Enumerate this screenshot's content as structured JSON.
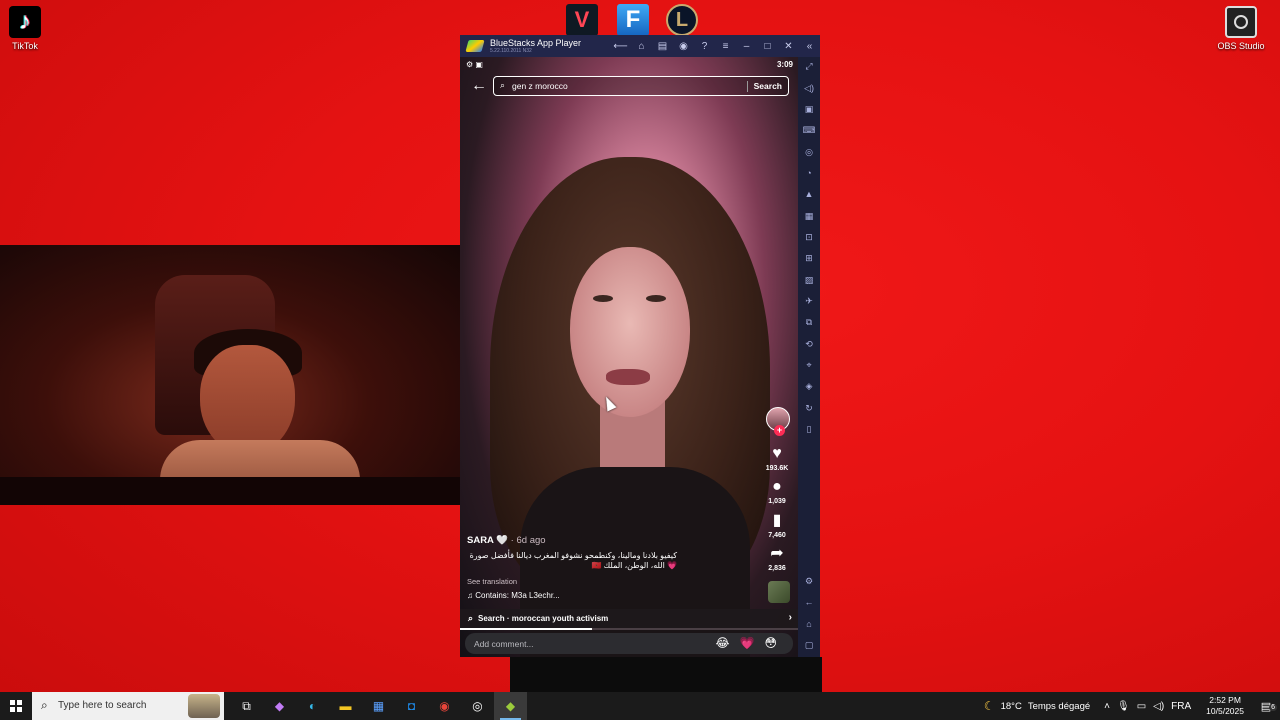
{
  "desktop": {
    "icons": [
      {
        "label": "TikTok",
        "icon": "tiktok-icon"
      },
      {
        "label": "OBS Studio",
        "icon": "obs-icon"
      }
    ],
    "top_apps": [
      "valorant-icon",
      "fortnite-icon",
      "league-of-legends-icon"
    ]
  },
  "bluestacks": {
    "title": "BlueStacks App Player",
    "version": "5.22.110.2011 N32",
    "title_icons": [
      "back-icon",
      "home-icon",
      "multi-instance-icon",
      "account-icon",
      "help-icon",
      "menu-icon",
      "minimize-icon",
      "maximize-icon",
      "close-icon",
      "collapse-sidebar-icon"
    ],
    "sidebar_icons": [
      "fullscreen-icon",
      "volume-icon",
      "media-icon",
      "keyboard-icon",
      "record-icon",
      "macro-icon",
      "game-controls-icon",
      "apk-icon",
      "screenshot-icon",
      "screen-record-icon",
      "media-manager-icon",
      "airplane-icon",
      "multi-instance-sync-icon",
      "rotate-icon",
      "location-icon",
      "layers-icon",
      "eco-mode-icon",
      "sidebar-toggle-icon",
      "settings-icon",
      "android-back-icon",
      "android-home-icon",
      "recent-apps-icon"
    ]
  },
  "phone": {
    "status_time": "3:09",
    "search": {
      "query": "gen z morocco",
      "button": "Search"
    },
    "actions": {
      "likes": "193.6K",
      "comments": "1,039",
      "saves": "7,460",
      "shares": "2,836"
    },
    "caption": {
      "author": "SARA 🤍",
      "ago": " · 6d ago",
      "text": "كيفيو بلادنا ومالينا، وكنطمحو نشوفو المغرب ديالنا فأفضل صورة 💗 الله، الوطن، الملك 🇲🇦",
      "translate": "See translation",
      "music": "♫ Contains: M3a L3echr..."
    },
    "search_suggestion": "Search · moroccan youth activism",
    "progress": 0.39,
    "comment_placeholder": "Add comment...",
    "comment_emojis": "😂💗😳"
  },
  "taskbar": {
    "search_placeholder": "Type here to search",
    "apps": [
      "task-view-icon",
      "copilot-icon",
      "edge-icon",
      "file-explorer-icon",
      "store-icon",
      "outlook-icon",
      "chrome-icon",
      "obs-taskbar-icon",
      "bluestacks-taskbar-icon"
    ],
    "weather_temp": "18°C",
    "weather_text": "Temps dégagé",
    "language": "FRA",
    "time": "2:52 PM",
    "date": "10/5/2025",
    "notification_count": "6"
  }
}
